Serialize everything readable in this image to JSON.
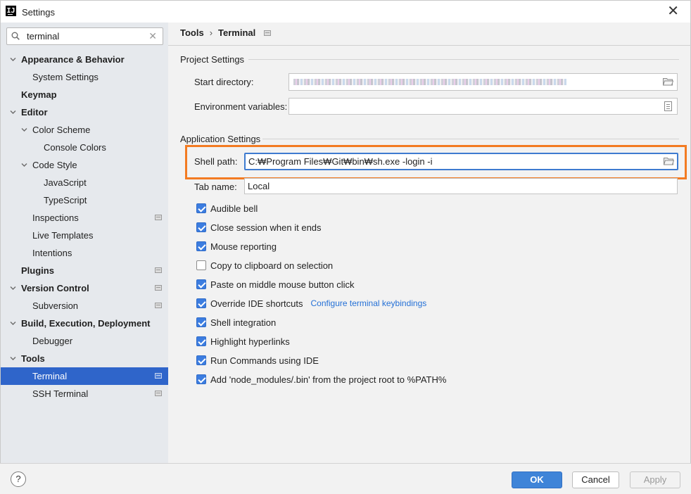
{
  "window": {
    "title": "Settings"
  },
  "search": {
    "value": "terminal"
  },
  "sidebar": {
    "items": [
      {
        "label": "Appearance & Behavior",
        "indent": 0,
        "bold": true,
        "arrow": "down",
        "proj": false,
        "selected": false
      },
      {
        "label": "System Settings",
        "indent": 1,
        "bold": false,
        "arrow": "none",
        "proj": false,
        "selected": false
      },
      {
        "label": "Keymap",
        "indent": 0,
        "bold": true,
        "arrow": "none",
        "proj": false,
        "selected": false
      },
      {
        "label": "Editor",
        "indent": 0,
        "bold": true,
        "arrow": "down",
        "proj": false,
        "selected": false
      },
      {
        "label": "Color Scheme",
        "indent": 1,
        "bold": false,
        "arrow": "down",
        "proj": false,
        "selected": false
      },
      {
        "label": "Console Colors",
        "indent": 2,
        "bold": false,
        "arrow": "none",
        "proj": false,
        "selected": false
      },
      {
        "label": "Code Style",
        "indent": 1,
        "bold": false,
        "arrow": "down",
        "proj": false,
        "selected": false
      },
      {
        "label": "JavaScript",
        "indent": 2,
        "bold": false,
        "arrow": "none",
        "proj": false,
        "selected": false
      },
      {
        "label": "TypeScript",
        "indent": 2,
        "bold": false,
        "arrow": "none",
        "proj": false,
        "selected": false
      },
      {
        "label": "Inspections",
        "indent": 1,
        "bold": false,
        "arrow": "none",
        "proj": true,
        "selected": false
      },
      {
        "label": "Live Templates",
        "indent": 1,
        "bold": false,
        "arrow": "none",
        "proj": false,
        "selected": false
      },
      {
        "label": "Intentions",
        "indent": 1,
        "bold": false,
        "arrow": "none",
        "proj": false,
        "selected": false
      },
      {
        "label": "Plugins",
        "indent": 0,
        "bold": true,
        "arrow": "none",
        "proj": true,
        "selected": false
      },
      {
        "label": "Version Control",
        "indent": 0,
        "bold": true,
        "arrow": "down",
        "proj": true,
        "selected": false
      },
      {
        "label": "Subversion",
        "indent": 1,
        "bold": false,
        "arrow": "none",
        "proj": true,
        "selected": false
      },
      {
        "label": "Build, Execution, Deployment",
        "indent": 0,
        "bold": true,
        "arrow": "down",
        "proj": false,
        "selected": false
      },
      {
        "label": "Debugger",
        "indent": 1,
        "bold": false,
        "arrow": "none",
        "proj": false,
        "selected": false
      },
      {
        "label": "Tools",
        "indent": 0,
        "bold": true,
        "arrow": "down",
        "proj": false,
        "selected": false
      },
      {
        "label": "Terminal",
        "indent": 1,
        "bold": false,
        "arrow": "none",
        "proj": true,
        "selected": true
      },
      {
        "label": "SSH Terminal",
        "indent": 1,
        "bold": false,
        "arrow": "none",
        "proj": true,
        "selected": false
      }
    ]
  },
  "breadcrumb": {
    "parent": "Tools",
    "separator": "›",
    "current": "Terminal"
  },
  "project_settings": {
    "heading": "Project Settings",
    "start_directory_label": "Start directory:",
    "environment_variables_label": "Environment variables:",
    "environment_variables_value": ""
  },
  "application_settings": {
    "heading": "Application Settings",
    "shell_path_label": "Shell path:",
    "shell_path_value": "C:₩Program Files₩Git₩bin₩sh.exe -login -i",
    "tab_name_label": "Tab name:",
    "tab_name_value": "Local"
  },
  "options": [
    {
      "label": "Audible bell",
      "checked": true
    },
    {
      "label": "Close session when it ends",
      "checked": true
    },
    {
      "label": "Mouse reporting",
      "checked": true
    },
    {
      "label": "Copy to clipboard on selection",
      "checked": false
    },
    {
      "label": "Paste on middle mouse button click",
      "checked": true
    },
    {
      "label": "Override IDE shortcuts",
      "checked": true,
      "link": "Configure terminal keybindings"
    },
    {
      "label": "Shell integration",
      "checked": true
    },
    {
      "label": "Highlight hyperlinks",
      "checked": true
    },
    {
      "label": "Run Commands using IDE",
      "checked": true
    },
    {
      "label": "Add 'node_modules/.bin' from the project root to %PATH%",
      "checked": true
    }
  ],
  "footer": {
    "help": "?",
    "ok": "OK",
    "cancel": "Cancel",
    "apply": "Apply"
  },
  "colors": {
    "selection": "#2f65ca",
    "highlight": "#f37b22",
    "checkbox": "#3c7de0",
    "link": "#2470d6",
    "ok_button": "#3f84d8"
  }
}
